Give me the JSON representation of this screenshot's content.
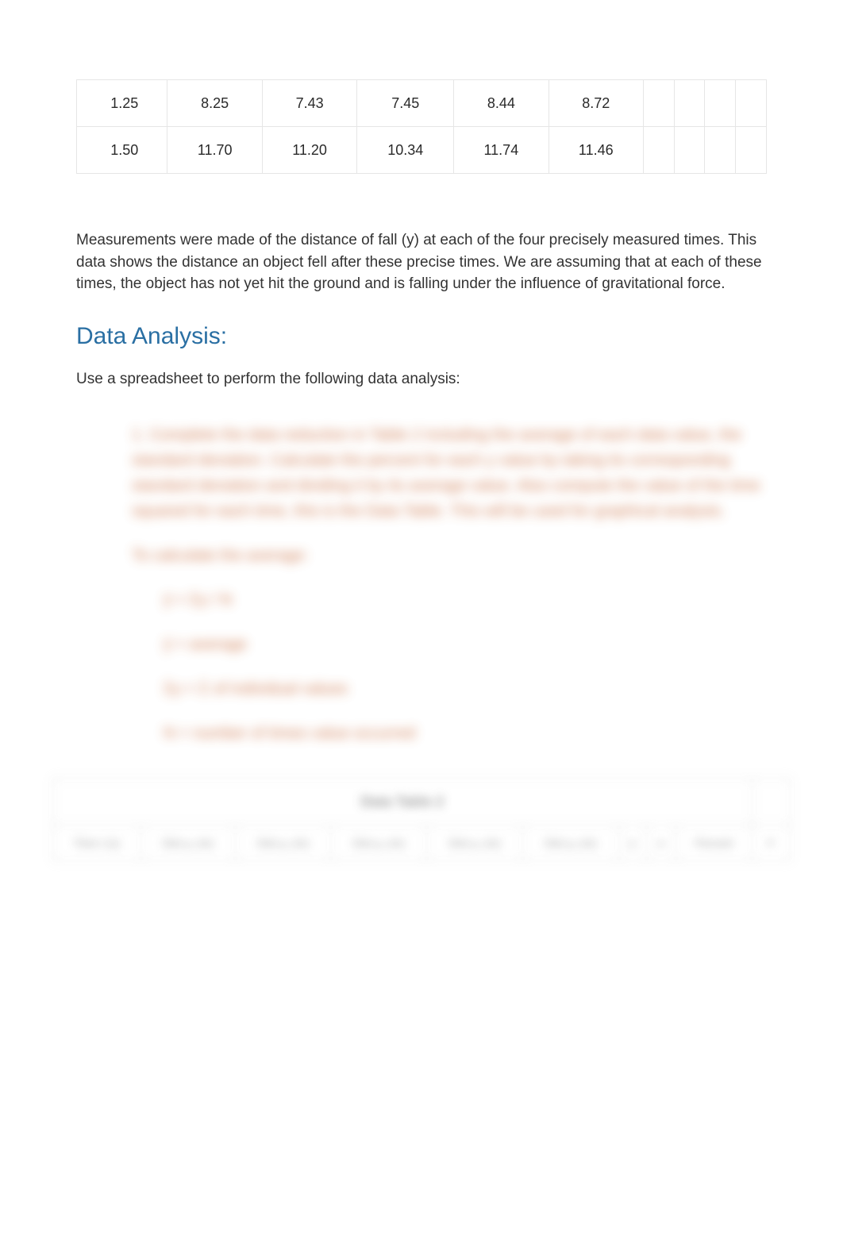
{
  "top_table": {
    "rows": [
      {
        "label": "1.25",
        "v1": "8.25",
        "v2": "7.43",
        "v3": "7.45",
        "v4": "8.44",
        "v5": "8.72"
      },
      {
        "label": "1.50",
        "v1": "11.70",
        "v2": "11.20",
        "v3": "10.34",
        "v4": "11.74",
        "v5": "11.46"
      }
    ]
  },
  "intro_paragraph": "Measurements were made of the distance of fall (y) at each of the four precisely measured times. This data shows the distance an object fell after these precise times. We are assuming that at each of these times, the object has not yet hit the ground and is falling under the influence of gravitational force.",
  "section_title": "Data Analysis:",
  "subtext": "Use a spreadsheet to perform the following data analysis:",
  "blurred": {
    "p1": "1.   Complete the data reduction in Table 2 including the average of each data value, the standard deviation. Calculate the percent for each y value by taking its corresponding standard deviation and dividing it by its average value. Also compute the value of the time squared for each time, this is the Data Table. This will be used for graphical analysis.",
    "l1": "To calculate the average:",
    "l2": "ȳ = Σy / N",
    "l3": "ȳ = average",
    "l4": "Σy = Σ of individual values",
    "l5": "N = number of times value occurred"
  },
  "blurred_table": {
    "title": "Data Table 2",
    "headers": [
      "Time t (s)",
      "Dist y₁ (m)",
      "Dist y₂ (m)",
      "Dist y₃ (m)",
      "Dist y₄ (m)",
      "Dist y₅ (m)",
      "ȳ",
      "σ",
      "Percent",
      "t²"
    ]
  }
}
